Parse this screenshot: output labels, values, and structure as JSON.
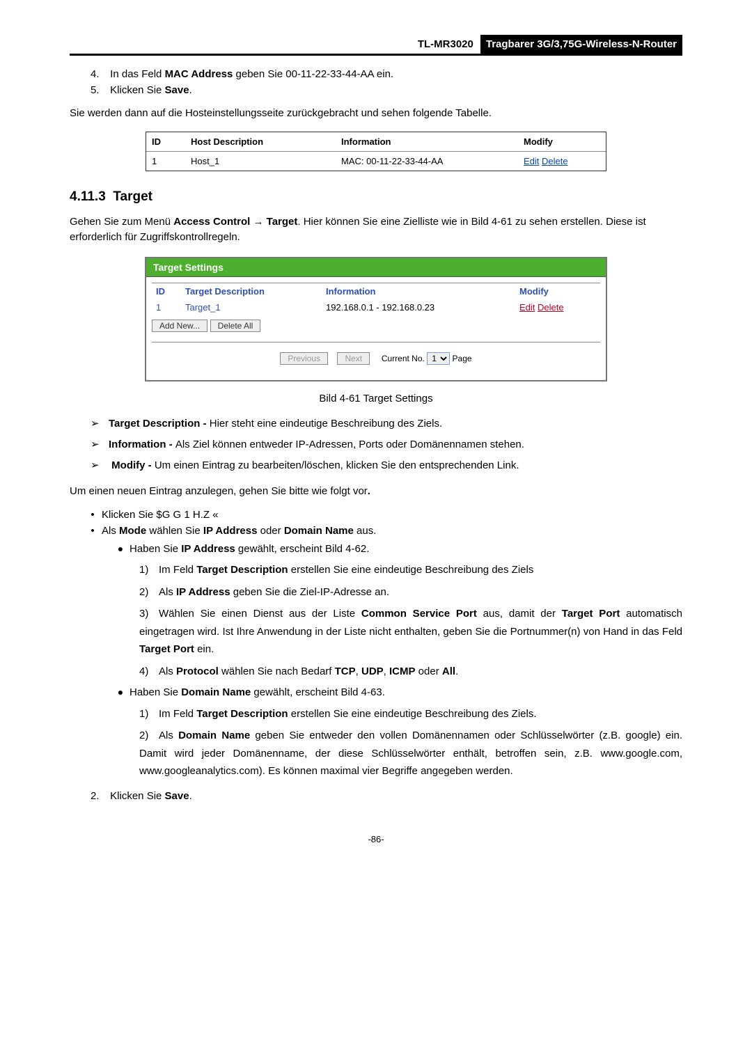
{
  "header": {
    "model": "TL-MR3020",
    "title": "Tragbarer 3G/3,75G-Wireless-N-Router"
  },
  "step4_pre": "In das Feld ",
  "step4_bold": "MAC Address",
  "step4_post": " geben Sie 00-11-22-33-44-AA ein.",
  "step5_pre": "Klicken Sie ",
  "step5_bold": "Save",
  "step5_post": ".",
  "intro_line": "Sie werden dann auf die Hosteinstellungsseite zurückgebracht und sehen folgende Tabelle.",
  "host_table": {
    "th_id": "ID",
    "th_desc": "Host Description",
    "th_info": "Information",
    "th_mod": "Modify",
    "r1_id": "1",
    "r1_desc": "Host_1",
    "r1_info": "MAC: 00-11-22-33-44-AA",
    "r1_edit": "Edit",
    "r1_delete": "Delete"
  },
  "section_no": "4.11.3",
  "section_title": "Target",
  "para1a": "Gehen Sie zum Menü ",
  "para1b": "Access Control",
  "para1c": " → ",
  "para1d": "Target",
  "para1e": ". Hier können Sie eine Zielliste wie in Bild 4-61 zu sehen erstellen. Diese ist erforderlich für Zugriffskontrollregeln.",
  "ts": {
    "title": "Target Settings",
    "th_id": "ID",
    "th_desc": "Target Description",
    "th_info": "Information",
    "th_mod": "Modify",
    "r1_id": "1",
    "r1_desc": "Target_1",
    "r1_info": "192.168.0.1 - 192.168.0.23",
    "r1_edit": "Edit",
    "r1_delete": "Delete",
    "btn_add": "Add New...",
    "btn_delall": "Delete All",
    "btn_prev": "Previous",
    "btn_next": "Next",
    "pg_label1": "Current No.",
    "pg_value": "1",
    "pg_label2": "Page"
  },
  "fig_caption": "Bild 4-61 Target Settings",
  "b1_bold": "Target Description - ",
  "b1_txt": "Hier steht eine eindeutige Beschreibung des Ziels.",
  "b2_bold": "Information - ",
  "b2_txt": "Als Ziel können entweder IP-Adressen, Ports oder Domänennamen stehen.",
  "b3_bold": "Modify - ",
  "b3_txt": "Um einen Eintrag zu bearbeiten/löschen, klicken Sie den entsprechenden Link.",
  "intro2a": "Um einen neuen Eintrag anzulegen, gehen Sie bitte wie folgt vor",
  "intro2b": ".",
  "di1": "Klicken Sie $G G 1 H.Z «",
  "di2_a": "Als ",
  "di2_b": "Mode",
  "di2_c": " wählen Sie ",
  "di2_d": "IP Address",
  "di2_e": " oder ",
  "di2_f": "Domain Name",
  "di2_g": " aus.",
  "sd1_a": "Haben Sie ",
  "sd1_b": "IP Address",
  "sd1_c": " gewählt, erscheint Bild 4-62.",
  "n1_a": "Im Feld ",
  "n1_b": "Target Description",
  "n1_c": " erstellen Sie eine eindeutige Beschreibung des Ziels",
  "n2_a": "Als ",
  "n2_b": "IP Address",
  "n2_c": " geben Sie die Ziel-IP-Adresse an.",
  "n3_a": "Wählen Sie einen Dienst aus der Liste ",
  "n3_b": "Common Service Port",
  "n3_c": " aus, damit der ",
  "n3_d": "Target Port",
  "n3_e": " automatisch eingetragen wird. Ist Ihre Anwendung in der Liste nicht enthalten, geben Sie die Portnummer(n) von Hand in das Feld ",
  "n3_f": "Target Port",
  "n3_g": " ein.",
  "n4_a": "Als ",
  "n4_b": "Protocol",
  "n4_c": " wählen Sie nach Bedarf ",
  "n4_d": "TCP",
  "n4_e": ", ",
  "n4_f": "UDP",
  "n4_g": ", ",
  "n4_h": "ICMP",
  "n4_i": " oder ",
  "n4_j": "All",
  "n4_k": ".",
  "sd2_a": "Haben Sie ",
  "sd2_b": "Domain Name",
  "sd2_c": " gewählt, erscheint Bild 4-63.",
  "m1_a": "Im Feld ",
  "m1_b": "Target Description",
  "m1_c": " erstellen Sie eine eindeutige Beschreibung des Ziels.",
  "m2_a": "Als ",
  "m2_b": "Domain Name",
  "m2_c": " geben Sie entweder den vollen Domänennamen oder Schlüsselwörter (z.B. google) ein. Damit wird jeder Domänenname, der diese Schlüsselwörter enthält, betroffen sein, z.B. www.google.com, www.googleanalytics.com). Es können maximal vier Begriffe angegeben werden.",
  "final2_a": "Klicken Sie ",
  "final2_b": "Save",
  "final2_c": ".",
  "page_no": "-86-"
}
